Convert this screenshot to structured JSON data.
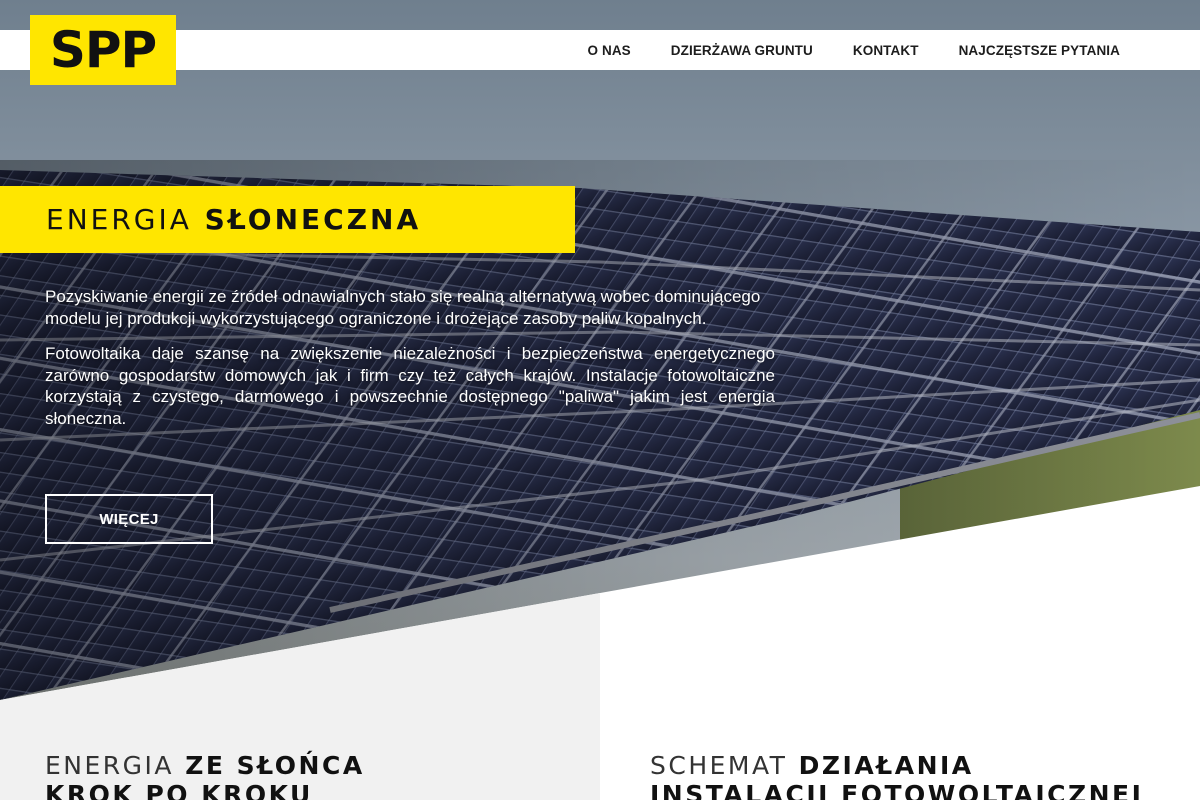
{
  "header": {
    "logo_text": "SPP",
    "nav": [
      {
        "label": "O NAS"
      },
      {
        "label": "DZIERŻAWA GRUNTU"
      },
      {
        "label": "KONTAKT"
      },
      {
        "label": "NAJCZĘSTSZE PYTANIA"
      }
    ]
  },
  "hero": {
    "title_thin": "ENERGIA",
    "title_bold": "SŁONECZNA",
    "paragraphs": [
      "Pozyskiwanie energii ze źródeł odnawialnych stało się realną alternatywą wobec dominującego modelu jej produkcji wykorzystującego ograniczone i drożejące zasoby paliw kopalnych.",
      "Fotowoltaika daje szansę na zwiększenie niezależności i bezpieczeństwa energetycznego zarówno gospodarstw domowych jak i firm czy też całych krajów. Instalacje fotowoltaiczne korzystają z czystego, darmowego i powszechnie dostępnego \"paliwa\" jakim jest energia słoneczna."
    ],
    "button_label": "WIĘCEJ"
  },
  "sections": {
    "left": {
      "line1_thin": "ENERGIA",
      "line1_bold": "ZE SŁOŃCA",
      "line2_bold": "KROK PO KROKU"
    },
    "right": {
      "line1_thin": "SCHEMAT",
      "line1_bold": "DZIAŁANIA",
      "line2_bold": "INSTALACJI FOTOWOLTAICZNEJ"
    }
  },
  "colors": {
    "accent": "#ffe600",
    "header_bg": "#ffffff",
    "left_panel_bg": "#f1f1f1",
    "right_panel_bg": "#ffffff",
    "sky": "#8a98a6",
    "panel_cell": "#262b48"
  }
}
